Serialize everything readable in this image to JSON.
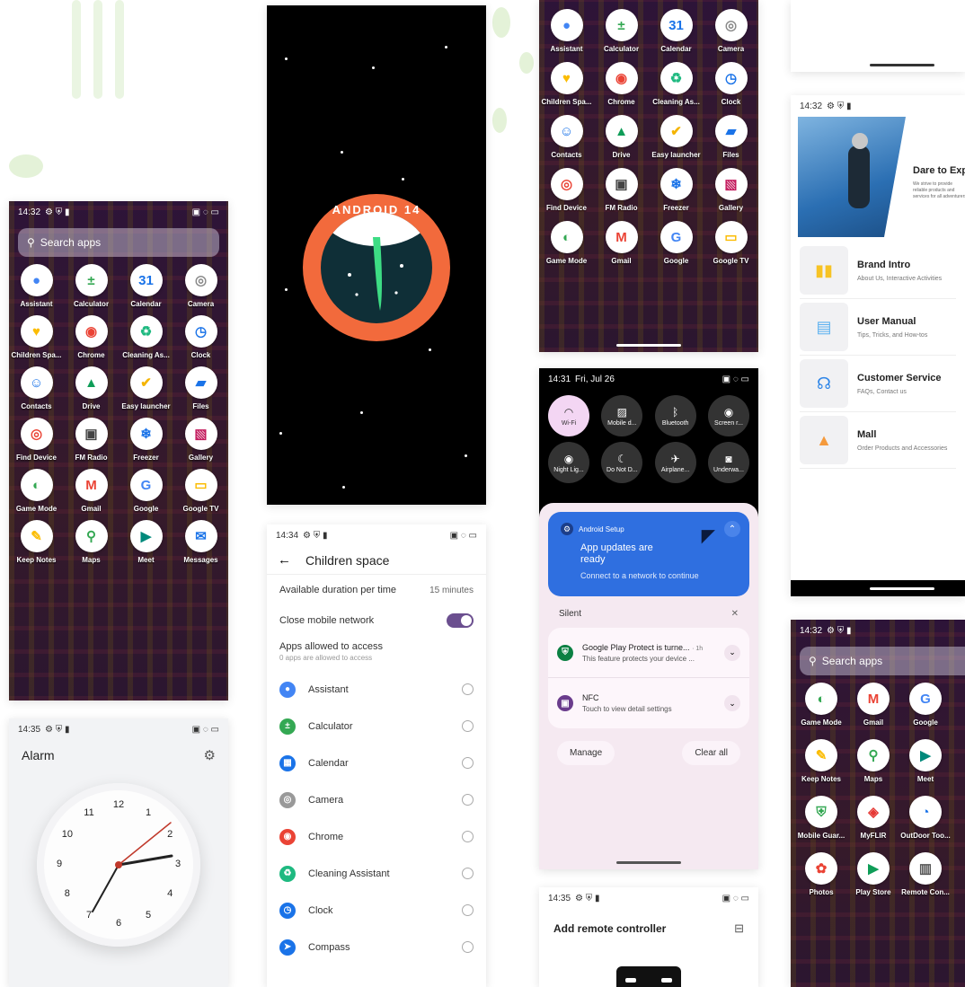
{
  "drawer_left": {
    "status": {
      "time": "14:32",
      "icons": "⚙ ⛨ ▮",
      "right": "▣ ◌ ▭"
    },
    "search_label": "Search apps",
    "apps": [
      {
        "label": "Assistant",
        "glyph": "●",
        "color": "#4285f4"
      },
      {
        "label": "Calculator",
        "glyph": "±",
        "color": "#34a853"
      },
      {
        "label": "Calendar",
        "glyph": "31",
        "color": "#1a73e8"
      },
      {
        "label": "Camera",
        "glyph": "◎",
        "color": "#888"
      },
      {
        "label": "Children Spa...",
        "glyph": "♥",
        "color": "#fbbc04"
      },
      {
        "label": "Chrome",
        "glyph": "◉",
        "color": "#ea4335"
      },
      {
        "label": "Cleaning As...",
        "glyph": "♻",
        "color": "#1eb980"
      },
      {
        "label": "Clock",
        "glyph": "◷",
        "color": "#1a73e8"
      },
      {
        "label": "Contacts",
        "glyph": "☺",
        "color": "#1a73e8"
      },
      {
        "label": "Drive",
        "glyph": "▲",
        "color": "#0f9d58"
      },
      {
        "label": "Easy launcher",
        "glyph": "✔",
        "color": "#f4b400"
      },
      {
        "label": "Files",
        "glyph": "▰",
        "color": "#1a73e8"
      },
      {
        "label": "Find Device",
        "glyph": "◎",
        "color": "#ea4335"
      },
      {
        "label": "FM Radio",
        "glyph": "▣",
        "color": "#444"
      },
      {
        "label": "Freezer",
        "glyph": "❄",
        "color": "#1a73e8"
      },
      {
        "label": "Gallery",
        "glyph": "▧",
        "color": "#c2185b"
      },
      {
        "label": "Game Mode",
        "glyph": "◐",
        "color": "#34a853"
      },
      {
        "label": "Gmail",
        "glyph": "M",
        "color": "#ea4335"
      },
      {
        "label": "Google",
        "glyph": "G",
        "color": "#4285f4"
      },
      {
        "label": "Google TV",
        "glyph": "▭",
        "color": "#fbbc04"
      },
      {
        "label": "Keep Notes",
        "glyph": "✎",
        "color": "#fbbc04"
      },
      {
        "label": "Maps",
        "glyph": "⚲",
        "color": "#34a853"
      },
      {
        "label": "Meet",
        "glyph": "▶",
        "color": "#00897b"
      },
      {
        "label": "Messages",
        "glyph": "✉",
        "color": "#1a73e8"
      }
    ]
  },
  "android14": {
    "badge": "ANDROID 14"
  },
  "children_space": {
    "status": {
      "time": "14:34",
      "icons": "⚙ ⛨ ▮",
      "right": "▣ ◌ ▭"
    },
    "title": "Children space",
    "back_glyph": "←",
    "duration_label": "Available duration per time",
    "duration_value": "15 minutes",
    "network_label": "Close mobile network",
    "network_on": true,
    "apps_allowed_title": "Apps allowed to access",
    "apps_allowed_sub": "0 apps are allowed to access",
    "apps": [
      {
        "label": "Assistant",
        "glyph": "●",
        "color": "#4285f4"
      },
      {
        "label": "Calculator",
        "glyph": "±",
        "color": "#34a853"
      },
      {
        "label": "Calendar",
        "glyph": "▦",
        "color": "#1a73e8"
      },
      {
        "label": "Camera",
        "glyph": "◎",
        "color": "#999"
      },
      {
        "label": "Chrome",
        "glyph": "◉",
        "color": "#ea4335"
      },
      {
        "label": "Cleaning Assistant",
        "glyph": "♻",
        "color": "#1eb980"
      },
      {
        "label": "Clock",
        "glyph": "◷",
        "color": "#1a73e8"
      },
      {
        "label": "Compass",
        "glyph": "➤",
        "color": "#1a73e8"
      }
    ]
  },
  "drawer_top": {
    "apps": [
      {
        "label": "Assistant",
        "glyph": "●",
        "color": "#4285f4"
      },
      {
        "label": "Calculator",
        "glyph": "±",
        "color": "#34a853"
      },
      {
        "label": "Calendar",
        "glyph": "31",
        "color": "#1a73e8"
      },
      {
        "label": "Camera",
        "glyph": "◎",
        "color": "#888"
      },
      {
        "label": "Children Spa...",
        "glyph": "♥",
        "color": "#fbbc04"
      },
      {
        "label": "Chrome",
        "glyph": "◉",
        "color": "#ea4335"
      },
      {
        "label": "Cleaning As...",
        "glyph": "♻",
        "color": "#1eb980"
      },
      {
        "label": "Clock",
        "glyph": "◷",
        "color": "#1a73e8"
      },
      {
        "label": "Contacts",
        "glyph": "☺",
        "color": "#1a73e8"
      },
      {
        "label": "Drive",
        "glyph": "▲",
        "color": "#0f9d58"
      },
      {
        "label": "Easy launcher",
        "glyph": "✔",
        "color": "#f4b400"
      },
      {
        "label": "Files",
        "glyph": "▰",
        "color": "#1a73e8"
      },
      {
        "label": "Find Device",
        "glyph": "◎",
        "color": "#ea4335"
      },
      {
        "label": "FM Radio",
        "glyph": "▣",
        "color": "#444"
      },
      {
        "label": "Freezer",
        "glyph": "❄",
        "color": "#1a73e8"
      },
      {
        "label": "Gallery",
        "glyph": "▧",
        "color": "#c2185b"
      },
      {
        "label": "Game Mode",
        "glyph": "◐",
        "color": "#34a853"
      },
      {
        "label": "Gmail",
        "glyph": "M",
        "color": "#ea4335"
      },
      {
        "label": "Google",
        "glyph": "G",
        "color": "#4285f4"
      },
      {
        "label": "Google TV",
        "glyph": "▭",
        "color": "#fbbc04"
      }
    ]
  },
  "notif": {
    "status": {
      "time": "14:31",
      "date": "Fri, Jul 26",
      "right": "▣ ◌ ▭"
    },
    "tiles": [
      {
        "label": "Wi-Fi",
        "glyph": "◠",
        "active": true
      },
      {
        "label": "Mobile d...",
        "glyph": "▨",
        "active": false
      },
      {
        "label": "Bluetooth",
        "glyph": "ᛒ",
        "active": false
      },
      {
        "label": "Screen r...",
        "glyph": "◉",
        "active": false
      },
      {
        "label": "Night Lig...",
        "glyph": "◉",
        "active": false
      },
      {
        "label": "Do Not D...",
        "glyph": "☾",
        "active": false
      },
      {
        "label": "Airplane...",
        "glyph": "✈",
        "active": false
      },
      {
        "label": "Underwa...",
        "glyph": "◙",
        "active": false
      }
    ],
    "setup_app": "Android Setup",
    "setup_title": "App updates are ready",
    "setup_body": "Connect to a network to continue",
    "silent_label": "Silent",
    "close_glyph": "✕",
    "items": [
      {
        "title": "Google Play Protect is turne...",
        "time": "· 1h",
        "body": "This feature protects your device ...",
        "glyph": "⛨",
        "color": "#0b8043"
      },
      {
        "title": "NFC",
        "time": "",
        "body": "Touch to view detail settings",
        "glyph": "▣",
        "color": "#6a3c8c"
      }
    ],
    "manage_label": "Manage",
    "clear_label": "Clear all"
  },
  "alarm": {
    "status": {
      "time": "14:35",
      "icons": "⚙ ⛨ ▮",
      "right": "▣ ◌ ▭"
    },
    "title": "Alarm",
    "numbers": [
      "12",
      "1",
      "2",
      "3",
      "4",
      "5",
      "6",
      "7",
      "8",
      "9",
      "10",
      "11"
    ]
  },
  "remote": {
    "status": {
      "time": "14:35",
      "icons": "⚙ ⛨ ▮",
      "right": "▣ ◌ ▭"
    },
    "title": "Add remote controller"
  },
  "brand": {
    "status": {
      "time": "14:32",
      "icons": "⚙ ⛨ ▮"
    },
    "hero_title": "Dare to Explore",
    "hero_body": "We strive to provide reliable products and services for all adventurers users a...",
    "items": [
      {
        "title": "Brand Intro",
        "sub": "About Us, Interactive Activities",
        "glyph": "▮▮",
        "color": "#f7c325"
      },
      {
        "title": "User Manual",
        "sub": "Tips, Tricks, and How-tos",
        "glyph": "▤",
        "color": "#5ab0f0"
      },
      {
        "title": "Customer Service",
        "sub": "FAQs, Contact us",
        "glyph": "☊",
        "color": "#2f86e8"
      },
      {
        "title": "Mall",
        "sub": "Order Products and Accessories",
        "glyph": "▲",
        "color": "#f59a3c"
      }
    ]
  },
  "drawer_right": {
    "status": {
      "time": "14:32",
      "icons": "⚙ ⛨ ▮"
    },
    "search_label": "Search apps",
    "apps": [
      {
        "label": "Game Mode",
        "glyph": "◐",
        "color": "#34a853"
      },
      {
        "label": "Gmail",
        "glyph": "M",
        "color": "#ea4335"
      },
      {
        "label": "Google",
        "glyph": "G",
        "color": "#4285f4"
      },
      {
        "label": "Keep Notes",
        "glyph": "✎",
        "color": "#fbbc04"
      },
      {
        "label": "Maps",
        "glyph": "⚲",
        "color": "#34a853"
      },
      {
        "label": "Meet",
        "glyph": "▶",
        "color": "#00897b"
      },
      {
        "label": "Mobile Guar...",
        "glyph": "⛨",
        "color": "#34a853"
      },
      {
        "label": "MyFLIR",
        "glyph": "◈",
        "color": "#e53935"
      },
      {
        "label": "OutDoor Too...",
        "glyph": "◔",
        "color": "#1a73e8"
      },
      {
        "label": "Photos",
        "glyph": "✿",
        "color": "#ea4335"
      },
      {
        "label": "Play Store",
        "glyph": "▶",
        "color": "#0f9d58"
      },
      {
        "label": "Remote Con...",
        "glyph": "▥",
        "color": "#555"
      }
    ]
  }
}
